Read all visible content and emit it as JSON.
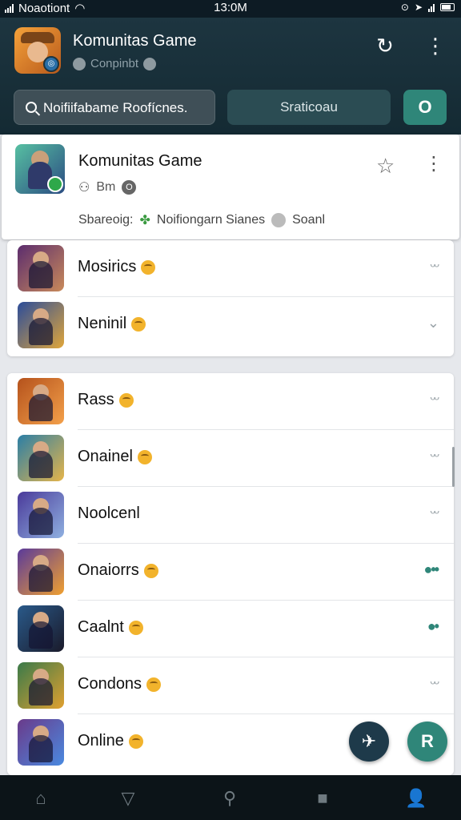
{
  "status_bar": {
    "carrier": "Noaotiont",
    "time": "13:0M"
  },
  "header": {
    "title": "Komunitas Game",
    "subtitle": "Conpinbt",
    "search_placeholder": "Noifiifabame Roofícnes.",
    "action_label": "Sraticoau",
    "action_icon_label": "O"
  },
  "featured": {
    "title": "Komunitas Game",
    "meta": "Bm",
    "meta_badge": "O",
    "desc_prefix": "Sbareoig:",
    "desc_middle": "Noifiongarn Sianes",
    "desc_suffix": "Soanl"
  },
  "list_a": [
    {
      "name": "Mosirics",
      "thumb": "#5b2c6e"
    },
    {
      "name": "Neninil",
      "thumb": "#2b4c9a"
    }
  ],
  "list_b": [
    {
      "name": "Rass",
      "thumb": "#b5521c"
    },
    {
      "name": "Onainel",
      "thumb": "#2a7ea6"
    },
    {
      "name": "Noolcenl",
      "thumb": "#4a3a9a"
    },
    {
      "name": "Onaiorrs",
      "thumb": "#c06a1a"
    },
    {
      "name": "Caalnt",
      "thumb": "#2a5a8a"
    },
    {
      "name": "Condons",
      "thumb": "#3a7a4a"
    },
    {
      "name": "Online",
      "thumb": "#6a3a8a"
    }
  ],
  "colors": {
    "accent": "#2f8679",
    "header_bg": "#1d3540"
  },
  "nav": [
    "home-icon",
    "filter-icon",
    "search-icon",
    "square-icon",
    "profile-icon"
  ]
}
